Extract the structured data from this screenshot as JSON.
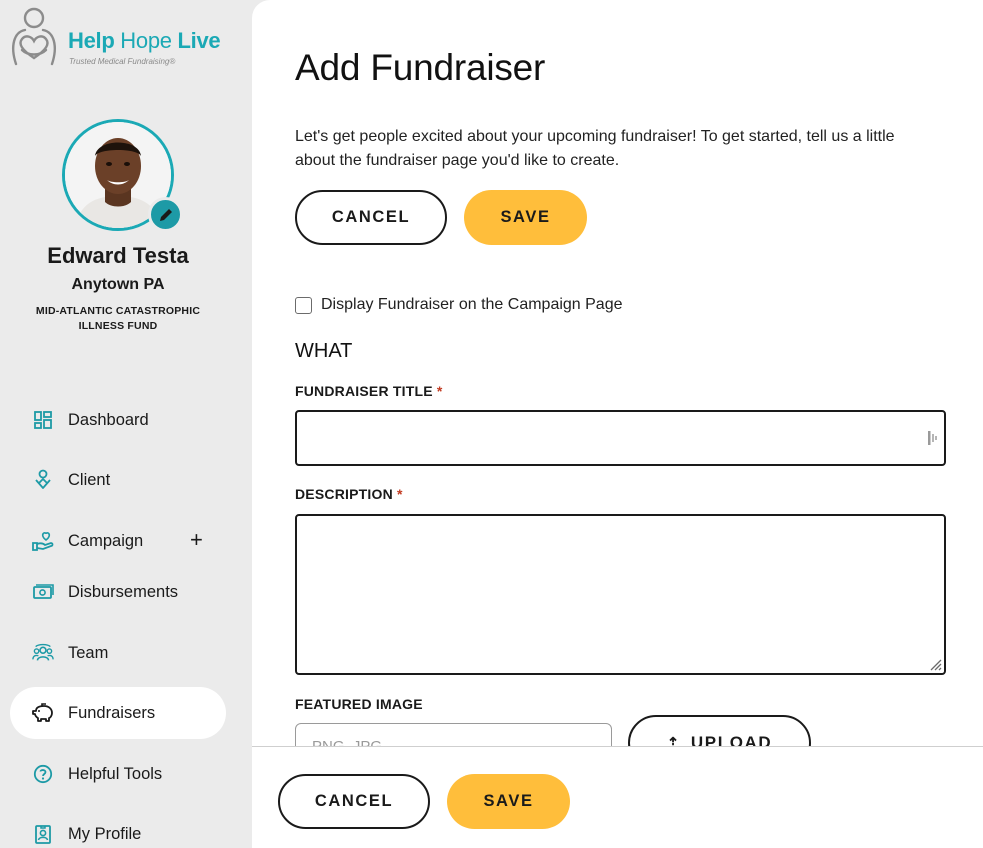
{
  "brand": {
    "name_part1": "Help",
    "name_part2": "Hope",
    "name_part3": "Live",
    "tagline": "Trusted Medical Fundraising®",
    "accent_color": "#1ba9b5"
  },
  "user": {
    "name": "Edward Testa",
    "location": "Anytown PA",
    "fund": "MID-ATLANTIC CATASTROPHIC ILLNESS FUND"
  },
  "sidebar": {
    "items": [
      {
        "label": "Dashboard",
        "icon": "dashboard-icon"
      },
      {
        "label": "Client",
        "icon": "client-icon"
      },
      {
        "label": "Campaign",
        "icon": "campaign-icon"
      },
      {
        "label": "Disbursements",
        "icon": "disbursements-icon"
      },
      {
        "label": "Team",
        "icon": "team-icon"
      },
      {
        "label": "Fundraisers",
        "icon": "piggy-bank-icon",
        "active": true
      },
      {
        "label": "Helpful Tools",
        "icon": "help-icon"
      },
      {
        "label": "My Profile",
        "icon": "profile-icon"
      }
    ],
    "campaign_expand": "+"
  },
  "page": {
    "title": "Add Fundraiser",
    "intro": "Let's get people excited about your upcoming fundraiser! To get started, tell us a little about the fundraiser page you'd like to create.",
    "cancel_label": "CANCEL",
    "save_label": "SAVE",
    "checkbox_label": "Display Fundraiser on the Campaign Page",
    "section_what": "WHAT",
    "fundraiser_title_label": "FUNDRAISER TITLE",
    "description_label": "DESCRIPTION",
    "required_mark": "*",
    "featured_image_label": "FEATURED IMAGE",
    "file_placeholder": "PNG, JPG",
    "upload_label": "UPLOAD"
  },
  "footer": {
    "cancel_label": "CANCEL",
    "save_label": "SAVE"
  },
  "colors": {
    "save_button": "#ffbe3b",
    "sidebar_bg": "#ebebeb",
    "icon_color": "#1d9aa6"
  }
}
